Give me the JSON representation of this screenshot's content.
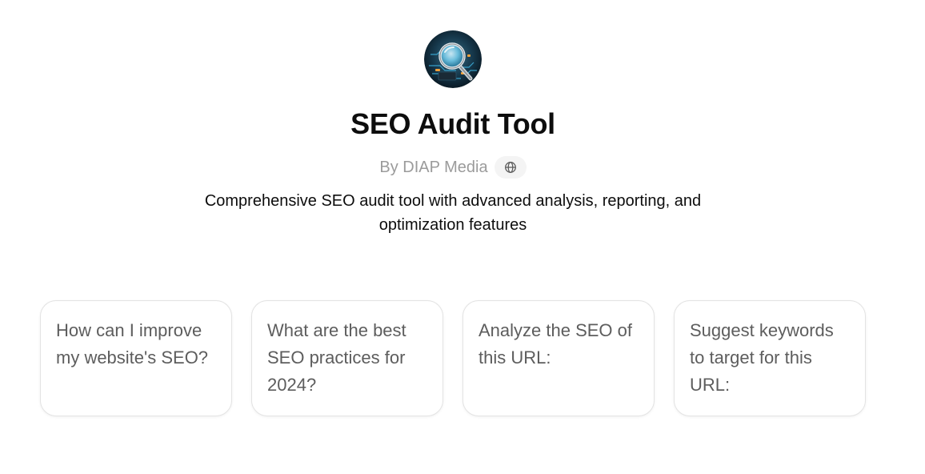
{
  "gpt": {
    "avatar_icon": "magnifying-glass-circuit-avatar",
    "title": "SEO Audit Tool",
    "author": "By DIAP Media",
    "website_icon": "globe-icon",
    "description": "Comprehensive SEO audit tool with advanced analysis, reporting, and optimization features"
  },
  "conversation_starters": [
    {
      "text": "How can I improve my website's SEO?"
    },
    {
      "text": "What are the best SEO practices for 2024?"
    },
    {
      "text": "Analyze the SEO of this URL:"
    },
    {
      "text": "Suggest keywords to target for this URL:"
    }
  ],
  "colors": {
    "title": "#0d0d0d",
    "author": "#9b9b9b",
    "card_text": "#5d5d5d",
    "card_border": "#e3e3e3",
    "pill_bg": "#f4f4f4"
  }
}
